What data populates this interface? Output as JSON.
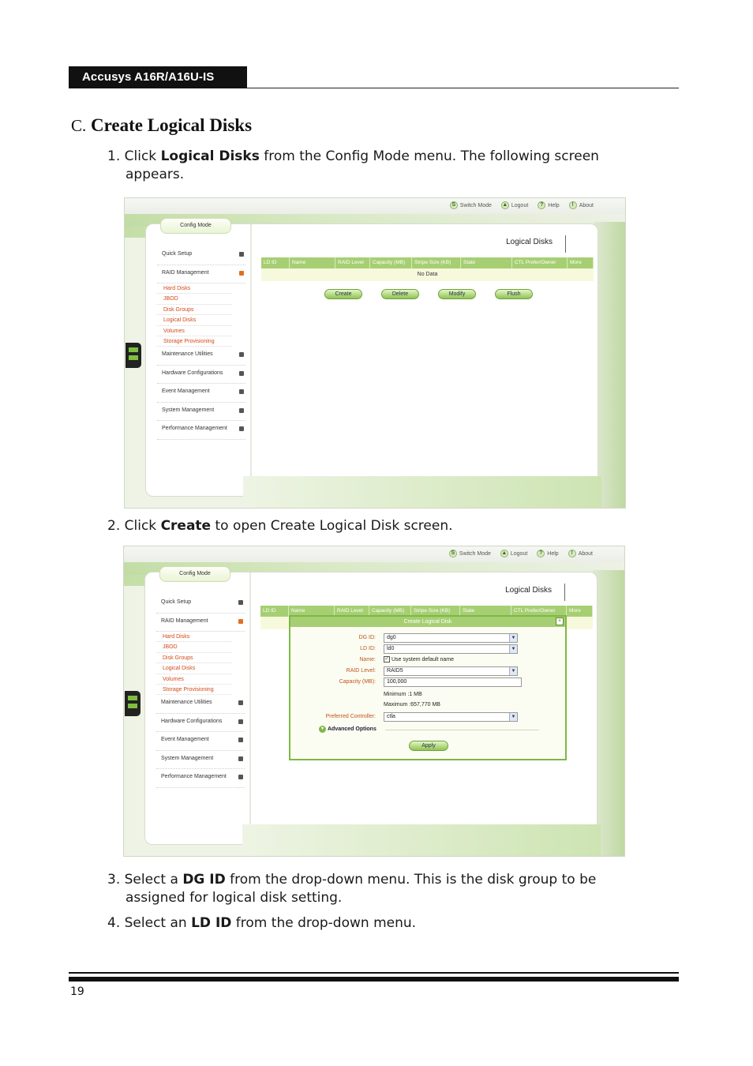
{
  "header": {
    "product": "Accusys A16R/A16U-IS"
  },
  "section": {
    "letter": "C.",
    "title": "Create Logical Disks"
  },
  "steps": [
    {
      "num": "1.",
      "pre": "Click ",
      "bold": "Logical Disks",
      "post": " from the Config Mode menu. The following screen",
      "cont": "appears."
    },
    {
      "num": "2.",
      "pre": "Click ",
      "bold": "Create",
      "post": " to open Create Logical Disk screen.",
      "cont": ""
    },
    {
      "num": "3.",
      "pre": "Select a ",
      "bold": "DG ID",
      "post": " from the drop-down menu. This is the disk group to be",
      "cont": "assigned for logical disk setting."
    },
    {
      "num": "4.",
      "pre": "Select an ",
      "bold": "LD ID",
      "post": " from the drop-down menu.",
      "cont": ""
    }
  ],
  "gui": {
    "topnav": [
      {
        "icon": "switch-icon",
        "glyph": "S",
        "label": "Switch Mode"
      },
      {
        "icon": "logout-icon",
        "glyph": "▲",
        "label": "Logout"
      },
      {
        "icon": "help-icon",
        "glyph": "?",
        "label": "Help"
      },
      {
        "icon": "about-icon",
        "glyph": "!",
        "label": "About"
      }
    ],
    "config_tab": "Config Mode",
    "menu": [
      "Quick Setup",
      "RAID Management",
      "Maintenance Utilities",
      "Hardware Configurations",
      "Event Management",
      "System Management",
      "Performance Management"
    ],
    "submenu": [
      "Hard Disks",
      "JBOD",
      "Disk Groups",
      "Logical Disks",
      "Volumes",
      "Storage Provisioning"
    ],
    "content_title": "Logical Disks",
    "columns": [
      "LD ID",
      "Name",
      "RAID Level",
      "Capacity (MB)",
      "Stripe Size (KB)",
      "State",
      "CTL Prefer/Owner",
      "More"
    ],
    "empty_row": "No Data",
    "buttons": [
      "Create",
      "Delete",
      "Modify",
      "Flush"
    ]
  },
  "dialog": {
    "title": "Create Logical Disk",
    "dg_id": {
      "label": "DG ID:",
      "value": "dg0"
    },
    "ld_id": {
      "label": "LD ID:",
      "value": "ld0"
    },
    "name": {
      "label": "Name:",
      "checkbox_label": "Use system default name",
      "checked": true
    },
    "raid_level": {
      "label": "RAID Level:",
      "value": "RAID5"
    },
    "capacity": {
      "label": "Capacity (MB):",
      "value": "100,000"
    },
    "minimum": "Minimum :1 MB",
    "maximum": "Maximum :657,770 MB",
    "preferred_controller": {
      "label": "Preferred Controller:",
      "value": "ctla"
    },
    "advanced": "Advanced Options",
    "apply": "Apply"
  },
  "footer": {
    "page_number": "19"
  }
}
